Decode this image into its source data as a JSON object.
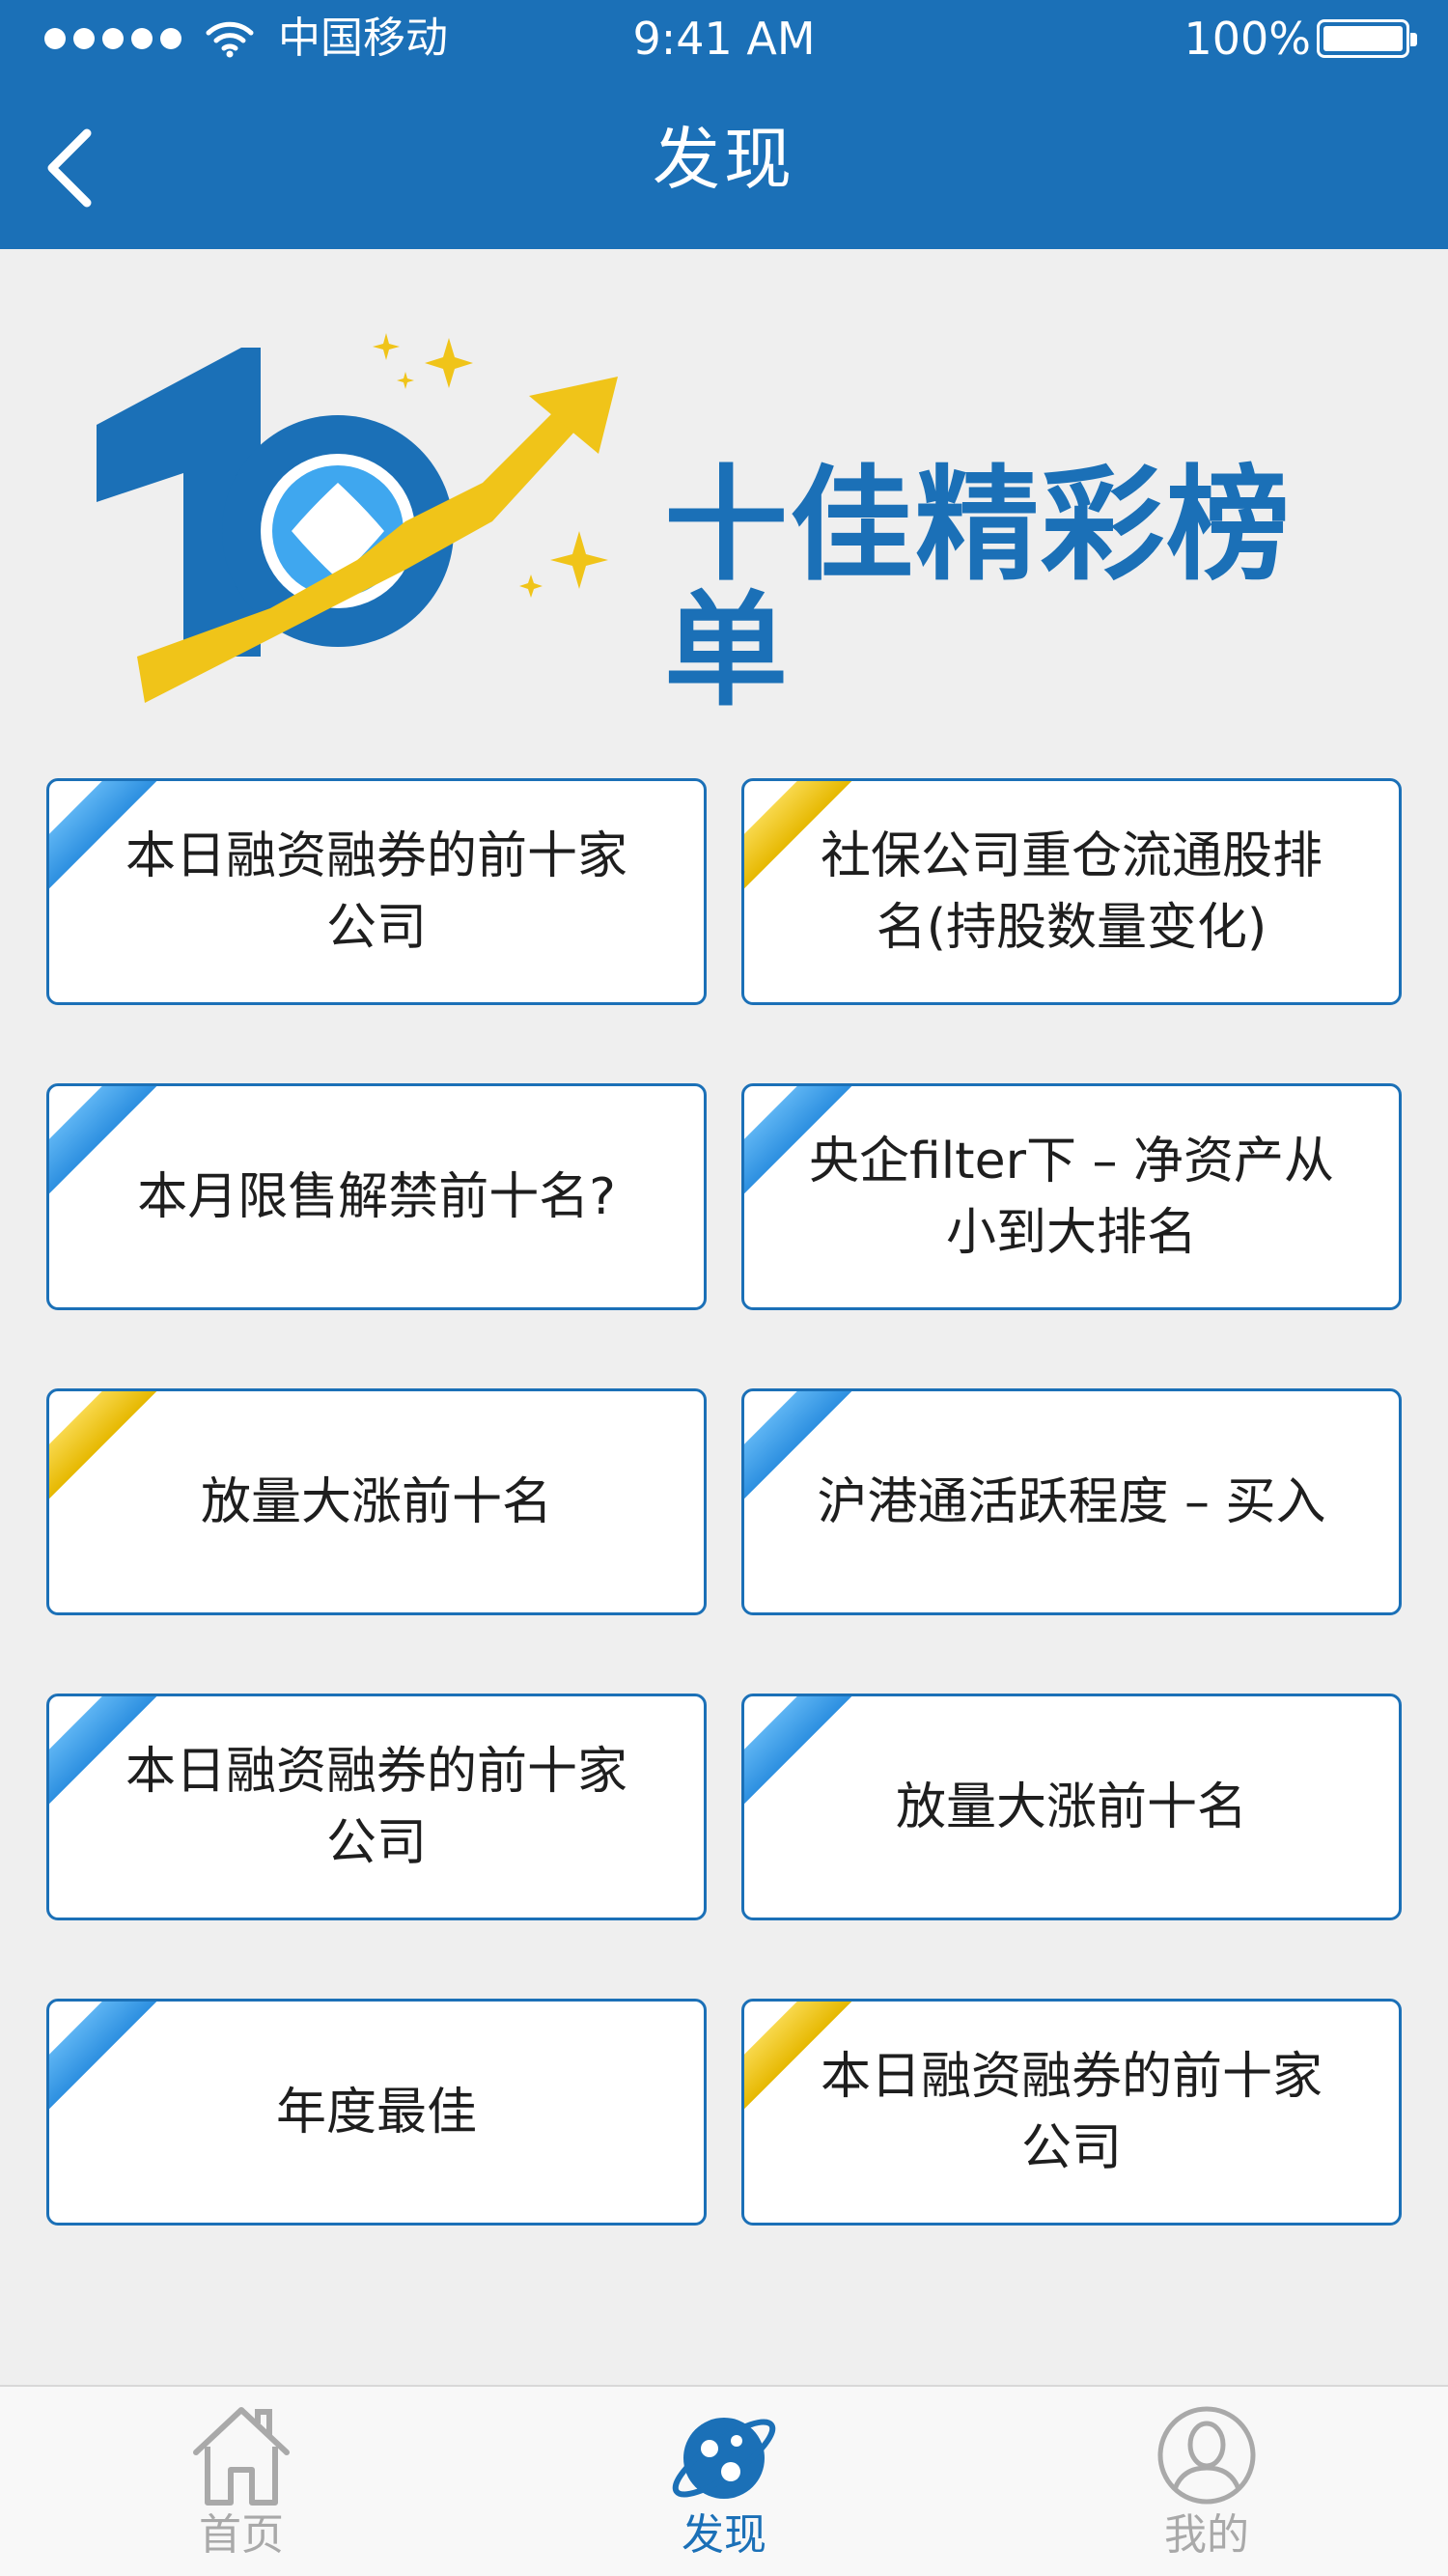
{
  "status_bar": {
    "carrier": "中国移动",
    "time": "9:41 AM",
    "battery": "100%"
  },
  "nav": {
    "title": "发现",
    "back_icon": "chevron-left-icon"
  },
  "banner": {
    "title": "十佳精彩榜单",
    "logo_icon": "top10-chart-logo"
  },
  "colors": {
    "primary": "#1b70b7",
    "ribbon_blue": "#3a9be8",
    "ribbon_gold": "#f0c419",
    "background": "#efefef"
  },
  "cards": [
    {
      "label": "本日融资融券的前十家公司",
      "ribbon": "blue"
    },
    {
      "label": "社保公司重仓流通股排名(持股数量变化)",
      "ribbon": "gold"
    },
    {
      "label": "本月限售解禁前十名?",
      "ribbon": "blue"
    },
    {
      "label": "央企filter下 – 净资产从小到大排名",
      "ribbon": "blue"
    },
    {
      "label": "放量大涨前十名",
      "ribbon": "gold"
    },
    {
      "label": "沪港通活跃程度 – 买入",
      "ribbon": "blue"
    },
    {
      "label": "本日融资融券的前十家公司",
      "ribbon": "blue"
    },
    {
      "label": "放量大涨前十名",
      "ribbon": "blue"
    },
    {
      "label": "年度最佳",
      "ribbon": "blue"
    },
    {
      "label": "本日融资融券的前十家公司",
      "ribbon": "gold"
    }
  ],
  "tabbar": {
    "items": [
      {
        "label": "首页",
        "icon": "home-icon",
        "color": "#a9a9a9",
        "active": false
      },
      {
        "label": "发现",
        "icon": "discover-planet-icon",
        "color": "#1b70b7",
        "active": true
      },
      {
        "label": "我的",
        "icon": "user-profile-icon",
        "color": "#a9a9a9",
        "active": false
      }
    ]
  }
}
